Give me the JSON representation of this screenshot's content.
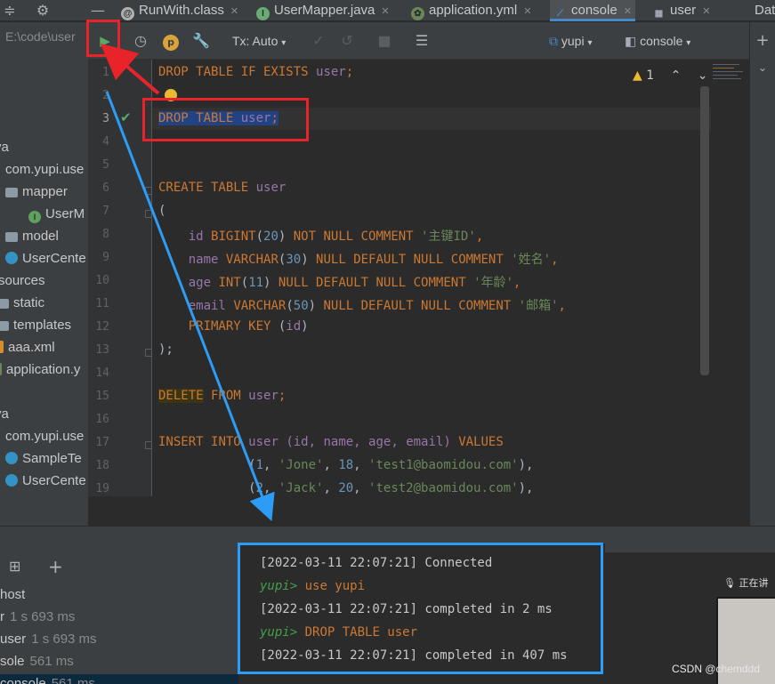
{
  "tabs": [
    {
      "label": "RunWith.class",
      "icon": "annotation-icon"
    },
    {
      "label": "UserMapper.java",
      "icon": "interface-icon"
    },
    {
      "label": "application.yml",
      "icon": "yml-icon"
    },
    {
      "label": "console",
      "icon": "console-icon",
      "active": true
    },
    {
      "label": "user",
      "icon": "table-icon"
    },
    {
      "label": "Dat",
      "icon": "database-icon"
    }
  ],
  "project": {
    "path": "E:\\code\\user",
    "items": [
      {
        "label": "va",
        "icon": ""
      },
      {
        "label": "com.yupi.use",
        "icon": ""
      },
      {
        "label": "mapper",
        "icon": "folder"
      },
      {
        "label": "UserM",
        "icon": "interface"
      },
      {
        "label": "model",
        "icon": "folder"
      },
      {
        "label": "UserCente",
        "icon": "class"
      },
      {
        "label": "sources",
        "icon": ""
      },
      {
        "label": "static",
        "icon": ""
      },
      {
        "label": "templates",
        "icon": ""
      },
      {
        "label": "aaa.xml",
        "icon": "xml"
      },
      {
        "label": "application.y",
        "icon": "yml"
      },
      {
        "label": "va",
        "icon": ""
      },
      {
        "label": "com.yupi.use",
        "icon": ""
      },
      {
        "label": "SampleTe",
        "icon": "class"
      },
      {
        "label": "UserCente",
        "icon": "class"
      }
    ]
  },
  "toolbar": {
    "tx": "Tx: Auto",
    "datasource": "yupi",
    "session": "console"
  },
  "inspection": {
    "count": "1"
  },
  "editor": {
    "line_numbers": [
      "1",
      "2",
      "3",
      "4",
      "5",
      "6",
      "7",
      "8",
      "9",
      "10",
      "11",
      "12",
      "13",
      "14",
      "15",
      "16",
      "17",
      "18",
      "19"
    ],
    "lines": {
      "l1": {
        "kw": "DROP TABLE IF EXISTS",
        "tbl": "user",
        "end": ";"
      },
      "l3": {
        "kw": "DROP TABLE",
        "tbl": "user",
        "end": ";"
      },
      "l6": {
        "kw": "CREATE TABLE",
        "tbl": "user"
      },
      "l7": "(",
      "l8": {
        "col": "id",
        "type": "BIGINT",
        "n": "20",
        "rest": "NOT NULL COMMENT",
        "str": "'主键ID'"
      },
      "l9": {
        "col": "name",
        "type": "VARCHAR",
        "n": "30",
        "rest": "NULL DEFAULT NULL COMMENT",
        "str": "'姓名'"
      },
      "l10": {
        "col": "age",
        "type": "INT",
        "n": "11",
        "rest": "NULL DEFAULT NULL COMMENT",
        "str": "'年龄'"
      },
      "l11": {
        "col": "email",
        "type": "VARCHAR",
        "n": "50",
        "rest": "NULL DEFAULT NULL COMMENT",
        "str": "'邮箱'"
      },
      "l12": {
        "kw": "PRIMARY KEY",
        "col": "id"
      },
      "l13": ");",
      "l15": {
        "kw1": "DELETE",
        "kw2": "FROM",
        "tbl": "user"
      },
      "l17": {
        "kw1": "INSERT",
        "kw2": "INTO",
        "tbl": "user",
        "cols": "(id, name, age, email)",
        "kw3": "VALUES"
      },
      "l18": {
        "id": "1",
        "name": "'Jone'",
        "age": "18",
        "email": "'test1@baomidou.com'"
      },
      "l19": {
        "id": "2",
        "name": "'Jack'",
        "age": "20",
        "email": "'test2@baomidou.com'"
      }
    }
  },
  "services": [
    {
      "label": "host",
      "time": ""
    },
    {
      "label": "r",
      "time": "1 s 693 ms"
    },
    {
      "label": "user",
      "time": "1 s 693 ms"
    },
    {
      "label": "sole",
      "time": "561 ms"
    },
    {
      "label": "console",
      "time": "561 ms"
    }
  ],
  "console": {
    "line1": "[2022-03-11 22:07:21] Connected",
    "line2_prompt": "yupi>",
    "line2_cmd": "use yupi",
    "line3": "[2022-03-11 22:07:21] completed in 2 ms",
    "line4_prompt": "yupi>",
    "line4_cmd": "DROP TABLE user",
    "line5": "[2022-03-11 22:07:21] completed in 407 ms"
  },
  "video": {
    "bar": "正在讲"
  },
  "watermark": "CSDN @chemddd"
}
